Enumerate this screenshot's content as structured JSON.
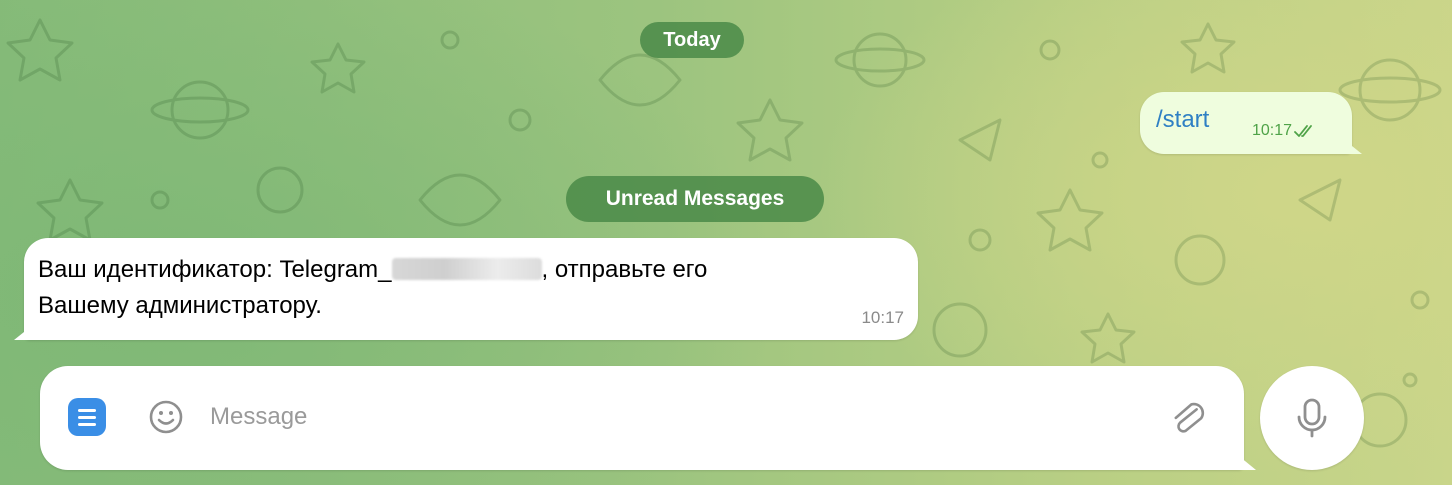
{
  "date_separator": "Today",
  "unread_separator": "Unread Messages",
  "outgoing_message": {
    "text": "/start",
    "time": "10:17",
    "status": "read"
  },
  "incoming_message": {
    "line1_prefix": "Ваш идентификатор: Telegram_",
    "line1_suffix": ", отправьте его",
    "line2": "Вашему администратору.",
    "time": "10:17"
  },
  "composer": {
    "placeholder": "Message",
    "value": ""
  },
  "icons": {
    "menu": "menu-icon",
    "emoji": "emoji-icon",
    "attach": "paperclip-icon",
    "mic": "microphone-icon",
    "read_status": "double-check-icon"
  },
  "colors": {
    "accent": "#3a8ee6",
    "outgoing_bubble": "#effdde",
    "outgoing_text": "#2f80c4",
    "read_check": "#4fa348",
    "service_pill": "#4a8a48"
  }
}
